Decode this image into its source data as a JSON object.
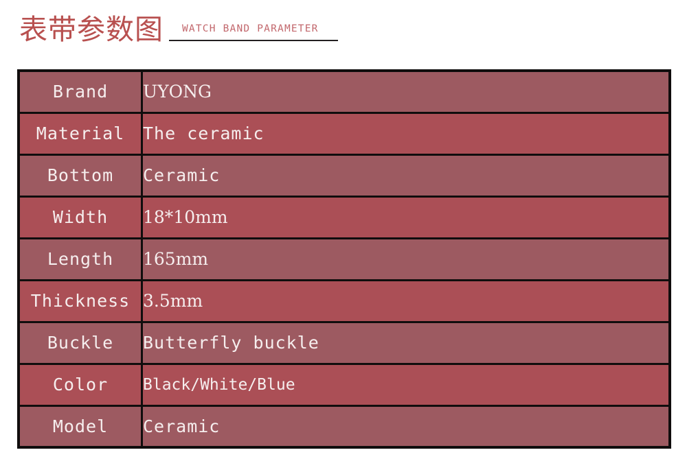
{
  "header": {
    "title_cn": "表带参数图",
    "title_en": "WATCH BAND PARAMETER",
    "title_color": "#b8504f",
    "subtitle_color": "#c2676c",
    "rule_color": "#231f20"
  },
  "table": {
    "border_color": "#100d0d",
    "row_color_a": "#9d5a61",
    "row_color_b": "#ab4f56",
    "text_color": "#f6eeee",
    "rows": [
      {
        "label": "Brand",
        "value": "UYONG"
      },
      {
        "label": "Material",
        "value": "The ceramic"
      },
      {
        "label": "Bottom",
        "value": "Ceramic"
      },
      {
        "label": "Width",
        "value": "18*10mm"
      },
      {
        "label": "Length",
        "value": "165mm"
      },
      {
        "label": "Thickness",
        "value": "3.5mm"
      },
      {
        "label": "Buckle",
        "value": "Butterfly buckle"
      },
      {
        "label": "Color",
        "value": "Black/White/Blue"
      },
      {
        "label": "Model",
        "value": "Ceramic"
      }
    ]
  }
}
